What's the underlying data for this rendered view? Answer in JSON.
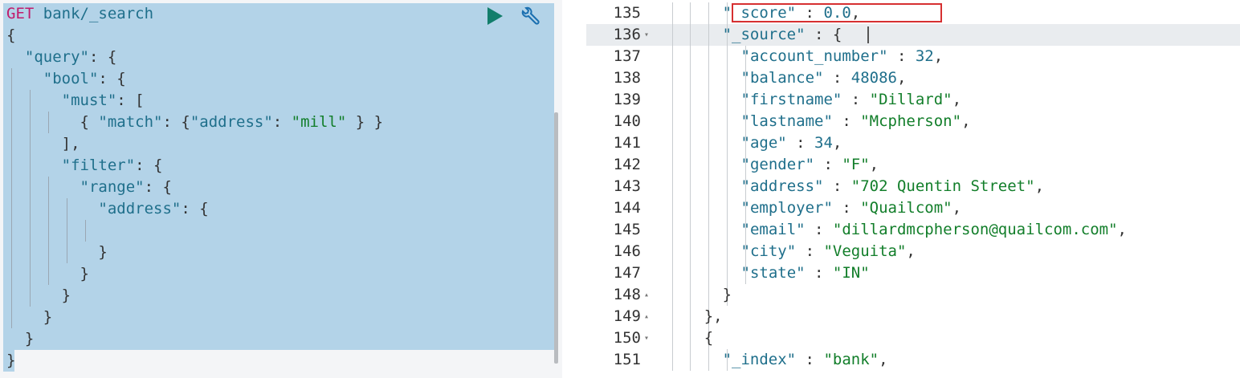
{
  "request_panel": {
    "lines": [
      [
        {
          "t": "GET",
          "c": "verb"
        },
        {
          "t": " ",
          "c": "punc"
        },
        {
          "t": "bank/_search",
          "c": "path"
        }
      ],
      [
        {
          "t": "{",
          "c": "punc"
        }
      ],
      [
        {
          "t": "  ",
          "c": "punc"
        },
        {
          "t": "\"query\"",
          "c": "key"
        },
        {
          "t": ": {",
          "c": "punc"
        }
      ],
      [
        {
          "t": "    ",
          "c": "punc"
        },
        {
          "t": "\"bool\"",
          "c": "key"
        },
        {
          "t": ": {",
          "c": "punc"
        }
      ],
      [
        {
          "t": "      ",
          "c": "punc"
        },
        {
          "t": "\"must\"",
          "c": "key"
        },
        {
          "t": ": [",
          "c": "punc"
        }
      ],
      [
        {
          "t": "        ",
          "c": "punc"
        },
        {
          "t": "{ ",
          "c": "punc"
        },
        {
          "t": "\"match\"",
          "c": "key"
        },
        {
          "t": ": {",
          "c": "punc"
        },
        {
          "t": "\"address\"",
          "c": "key"
        },
        {
          "t": ": ",
          "c": "punc"
        },
        {
          "t": "\"mill\"",
          "c": "str"
        },
        {
          "t": " } }",
          "c": "punc"
        }
      ],
      [
        {
          "t": "      ",
          "c": "punc"
        },
        {
          "t": "],",
          "c": "punc"
        }
      ],
      [
        {
          "t": "      ",
          "c": "punc"
        },
        {
          "t": "\"filter\"",
          "c": "key"
        },
        {
          "t": ": {",
          "c": "punc"
        }
      ],
      [
        {
          "t": "        ",
          "c": "punc"
        },
        {
          "t": "\"range\"",
          "c": "key"
        },
        {
          "t": ": {",
          "c": "punc"
        }
      ],
      [
        {
          "t": "          ",
          "c": "punc"
        },
        {
          "t": "\"address\"",
          "c": "key"
        },
        {
          "t": ": {",
          "c": "punc"
        }
      ],
      [
        {
          "t": "            ",
          "c": "punc"
        }
      ],
      [
        {
          "t": "          ",
          "c": "punc"
        },
        {
          "t": "}",
          "c": "punc"
        }
      ],
      [
        {
          "t": "        ",
          "c": "punc"
        },
        {
          "t": "}",
          "c": "punc"
        }
      ],
      [
        {
          "t": "      ",
          "c": "punc"
        },
        {
          "t": "}",
          "c": "punc"
        }
      ],
      [
        {
          "t": "    ",
          "c": "punc"
        },
        {
          "t": "}",
          "c": "punc"
        }
      ],
      [
        {
          "t": "  ",
          "c": "punc"
        },
        {
          "t": "}",
          "c": "punc"
        }
      ],
      [
        {
          "t": "}",
          "c": "punc"
        }
      ]
    ],
    "guides": [
      [],
      [],
      [],
      [
        1
      ],
      [
        1,
        2
      ],
      [
        1,
        2,
        3
      ],
      [
        1,
        2
      ],
      [
        1,
        2
      ],
      [
        1,
        2,
        3
      ],
      [
        1,
        2,
        3,
        4
      ],
      [
        1,
        2,
        3,
        4,
        5
      ],
      [
        1,
        2,
        3,
        4
      ],
      [
        1,
        2,
        3
      ],
      [
        1,
        2
      ],
      [
        1
      ],
      [],
      []
    ],
    "run_icon": "play-icon",
    "settings_icon": "wrench-icon",
    "colors": {
      "verb": "#c11c6c",
      "key": "#1f6f8b",
      "string": "#127e2a",
      "selection": "#b3d3e8",
      "run": "#127e6b"
    }
  },
  "response_panel": {
    "active_line": "136",
    "highlight_line": "135",
    "lines": [
      {
        "n": "135",
        "fold": "",
        "indent": 4,
        "segs": [
          {
            "t": "\"_score\"",
            "c": "key"
          },
          {
            "t": " : ",
            "c": "punc"
          },
          {
            "t": "0.0",
            "c": "num"
          },
          {
            "t": ",",
            "c": "punc"
          }
        ]
      },
      {
        "n": "136",
        "fold": "▾",
        "indent": 4,
        "segs": [
          {
            "t": "\"_source\"",
            "c": "key"
          },
          {
            "t": " : {",
            "c": "punc"
          }
        ]
      },
      {
        "n": "137",
        "fold": "",
        "indent": 5,
        "segs": [
          {
            "t": "\"account_number\"",
            "c": "key"
          },
          {
            "t": " : ",
            "c": "punc"
          },
          {
            "t": "32",
            "c": "num"
          },
          {
            "t": ",",
            "c": "punc"
          }
        ]
      },
      {
        "n": "138",
        "fold": "",
        "indent": 5,
        "segs": [
          {
            "t": "\"balance\"",
            "c": "key"
          },
          {
            "t": " : ",
            "c": "punc"
          },
          {
            "t": "48086",
            "c": "num"
          },
          {
            "t": ",",
            "c": "punc"
          }
        ]
      },
      {
        "n": "139",
        "fold": "",
        "indent": 5,
        "segs": [
          {
            "t": "\"firstname\"",
            "c": "key"
          },
          {
            "t": " : ",
            "c": "punc"
          },
          {
            "t": "\"Dillard\"",
            "c": "str"
          },
          {
            "t": ",",
            "c": "punc"
          }
        ]
      },
      {
        "n": "140",
        "fold": "",
        "indent": 5,
        "segs": [
          {
            "t": "\"lastname\"",
            "c": "key"
          },
          {
            "t": " : ",
            "c": "punc"
          },
          {
            "t": "\"Mcpherson\"",
            "c": "str"
          },
          {
            "t": ",",
            "c": "punc"
          }
        ]
      },
      {
        "n": "141",
        "fold": "",
        "indent": 5,
        "segs": [
          {
            "t": "\"age\"",
            "c": "key"
          },
          {
            "t": " : ",
            "c": "punc"
          },
          {
            "t": "34",
            "c": "num"
          },
          {
            "t": ",",
            "c": "punc"
          }
        ]
      },
      {
        "n": "142",
        "fold": "",
        "indent": 5,
        "segs": [
          {
            "t": "\"gender\"",
            "c": "key"
          },
          {
            "t": " : ",
            "c": "punc"
          },
          {
            "t": "\"F\"",
            "c": "str"
          },
          {
            "t": ",",
            "c": "punc"
          }
        ]
      },
      {
        "n": "143",
        "fold": "",
        "indent": 5,
        "segs": [
          {
            "t": "\"address\"",
            "c": "key"
          },
          {
            "t": " : ",
            "c": "punc"
          },
          {
            "t": "\"702 Quentin Street\"",
            "c": "str"
          },
          {
            "t": ",",
            "c": "punc"
          }
        ]
      },
      {
        "n": "144",
        "fold": "",
        "indent": 5,
        "segs": [
          {
            "t": "\"employer\"",
            "c": "key"
          },
          {
            "t": " : ",
            "c": "punc"
          },
          {
            "t": "\"Quailcom\"",
            "c": "str"
          },
          {
            "t": ",",
            "c": "punc"
          }
        ]
      },
      {
        "n": "145",
        "fold": "",
        "indent": 5,
        "segs": [
          {
            "t": "\"email\"",
            "c": "key"
          },
          {
            "t": " : ",
            "c": "punc"
          },
          {
            "t": "\"dillardmcpherson@quailcom.com\"",
            "c": "str"
          },
          {
            "t": ",",
            "c": "punc"
          }
        ]
      },
      {
        "n": "146",
        "fold": "",
        "indent": 5,
        "segs": [
          {
            "t": "\"city\"",
            "c": "key"
          },
          {
            "t": " : ",
            "c": "punc"
          },
          {
            "t": "\"Veguita\"",
            "c": "str"
          },
          {
            "t": ",",
            "c": "punc"
          }
        ]
      },
      {
        "n": "147",
        "fold": "",
        "indent": 5,
        "segs": [
          {
            "t": "\"state\"",
            "c": "key"
          },
          {
            "t": " : ",
            "c": "punc"
          },
          {
            "t": "\"IN\"",
            "c": "str"
          }
        ]
      },
      {
        "n": "148",
        "fold": "▴",
        "indent": 4,
        "segs": [
          {
            "t": "}",
            "c": "punc"
          }
        ]
      },
      {
        "n": "149",
        "fold": "▴",
        "indent": 3,
        "segs": [
          {
            "t": "},",
            "c": "punc"
          }
        ]
      },
      {
        "n": "150",
        "fold": "▾",
        "indent": 3,
        "segs": [
          {
            "t": "{",
            "c": "punc"
          }
        ]
      },
      {
        "n": "151",
        "fold": "",
        "indent": 4,
        "segs": [
          {
            "t": "\"_index\"",
            "c": "key"
          },
          {
            "t": " : ",
            "c": "punc"
          },
          {
            "t": "\"bank\"",
            "c": "str"
          },
          {
            "t": ",",
            "c": "punc"
          }
        ]
      }
    ],
    "colors": {
      "highlight_box": "#d63031",
      "active_line_bg": "#e9ecef"
    }
  }
}
